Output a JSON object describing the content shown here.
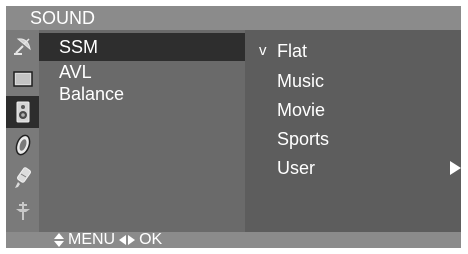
{
  "title": "SOUND",
  "icons": [
    "satellite-dish-icon",
    "screen-icon",
    "speaker-icon",
    "clock-icon",
    "key-icon",
    "plug-icon"
  ],
  "menu": {
    "items": [
      "SSM",
      "AVL",
      "Balance"
    ],
    "selected": "SSM"
  },
  "submenu": {
    "check_mark": "v",
    "items": [
      "Flat",
      "Music",
      "Movie",
      "Sports",
      "User"
    ],
    "selected": "Flat"
  },
  "bottom_bar": {
    "menu_label": "MENU",
    "ok_label": "OK"
  }
}
